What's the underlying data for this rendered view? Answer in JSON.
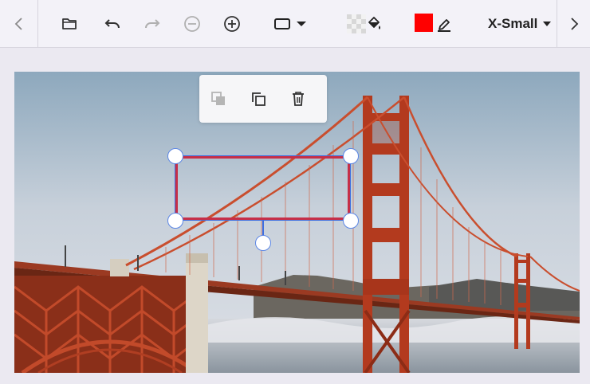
{
  "toolbar": {
    "font_size_value": "X-Small",
    "stroke_color": "#ff0000",
    "items": [
      {
        "name": "scroll-left",
        "icon": "chevron-left-icon"
      },
      {
        "name": "open",
        "icon": "folder-icon"
      },
      {
        "name": "undo",
        "icon": "undo-icon"
      },
      {
        "name": "redo",
        "icon": "redo-icon",
        "disabled": true
      },
      {
        "name": "zoom-out",
        "icon": "minus-circle-icon",
        "disabled": true
      },
      {
        "name": "zoom-in",
        "icon": "plus-circle-icon"
      },
      {
        "name": "shape",
        "icon": "rectangle-icon"
      },
      {
        "name": "fill",
        "icon": "paint-bucket-icon"
      },
      {
        "name": "stroke",
        "icon": "pen-icon"
      },
      {
        "name": "scroll-right",
        "icon": "chevron-right-icon"
      }
    ]
  },
  "context_menu": {
    "items": [
      {
        "name": "bring-forward",
        "icon": "layers-icon",
        "disabled": true
      },
      {
        "name": "duplicate",
        "icon": "copy-icon"
      },
      {
        "name": "delete",
        "icon": "trash-icon"
      }
    ]
  },
  "colors": {
    "selection_stroke": "#c62f48",
    "handle_border": "#5b86e5",
    "accent": "#3d6ee0"
  }
}
